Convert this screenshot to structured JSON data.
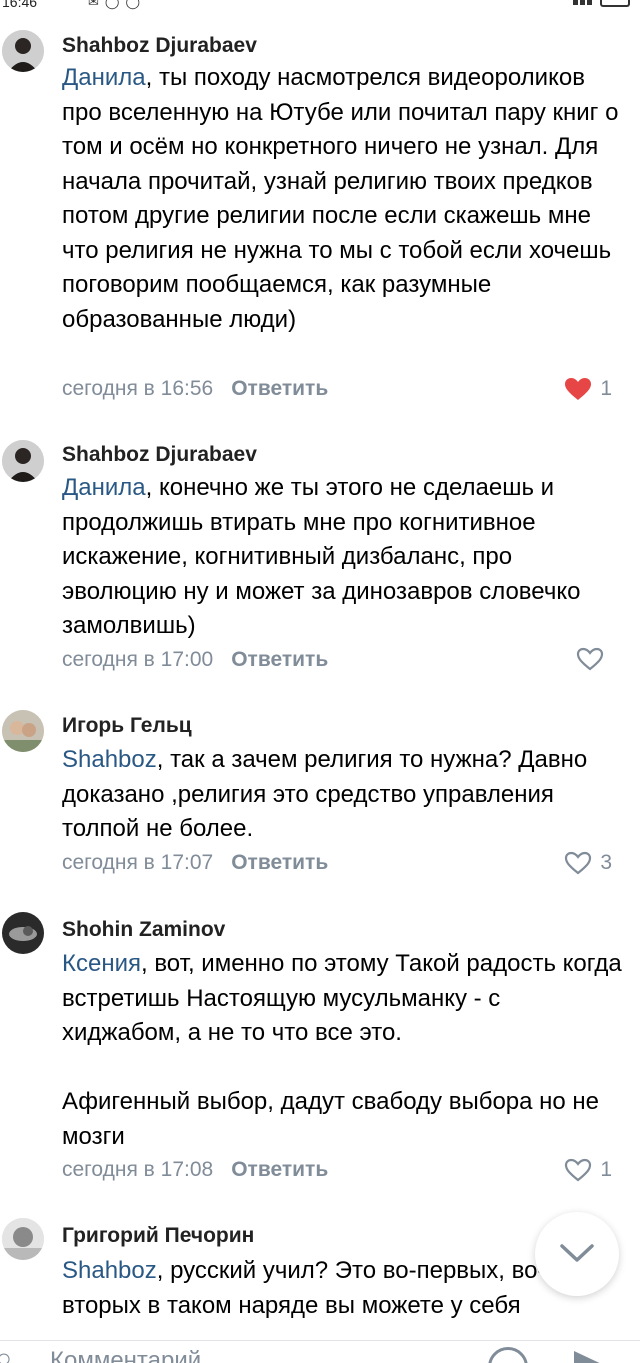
{
  "status_bar": {
    "time": "16:46"
  },
  "comments": [
    {
      "author": "Shahboz Djurabaev",
      "mention": "Данила",
      "text": ", ты походу насмотрелся видеороликов про вселенную на Ютубе или почитал пару книг о том и осём но конкретного ничего не узнал. Для начала прочитай, узнай религию твоих предков потом другие религии после если скажешь мне что религия не нужна то мы с тобой если хочешь поговорим пообщаемся, как разумные образованные люди)",
      "time": "сегодня в 16:56",
      "reply_label": "Ответить",
      "likes": "1",
      "liked": true
    },
    {
      "author": "Shahboz Djurabaev",
      "mention": "Данила",
      "text": ", конечно же ты этого не сделаешь и продолжишь втирать мне про когнитивное искажение, когнитивный дизбаланс, про эволюцию ну и может за динозавров словечко замолвишь)",
      "time": "сегодня в 17:00",
      "reply_label": "Ответить",
      "likes": "",
      "liked": false
    },
    {
      "author": "Игорь Гельц",
      "mention": "Shahboz",
      "text": ", так а зачем религия то нужна? Давно доказано ,религия это средство управления толпой не более.",
      "time": "сегодня в 17:07",
      "reply_label": "Ответить",
      "likes": "3",
      "liked": false
    },
    {
      "author": "Shohin Zaminov",
      "mention": "Ксения",
      "text": ", вот, именно по этому Такой радость когда встретишь Настоящую мусульманку - с хиджабом, а не то что все это.",
      "text2": "Афигенный выбор, дадут свабоду выбора но не мозги",
      "time": "сегодня в 17:08",
      "reply_label": "Ответить",
      "likes": "1",
      "liked": false
    },
    {
      "author": "Григорий Печорин",
      "mention": "Shahboz",
      "text": ", русский учил? Это во-первых, во-вторых в таком наряде вы можете у себя"
    }
  ],
  "composer": {
    "placeholder": "Комментарий"
  },
  "colors": {
    "mention": "#2a5885",
    "secondary": "#818c99",
    "like_active": "#e64646"
  },
  "icons": [
    "heart-icon",
    "chevron-down-icon",
    "plus-icon",
    "emoji-icon",
    "send-icon"
  ]
}
